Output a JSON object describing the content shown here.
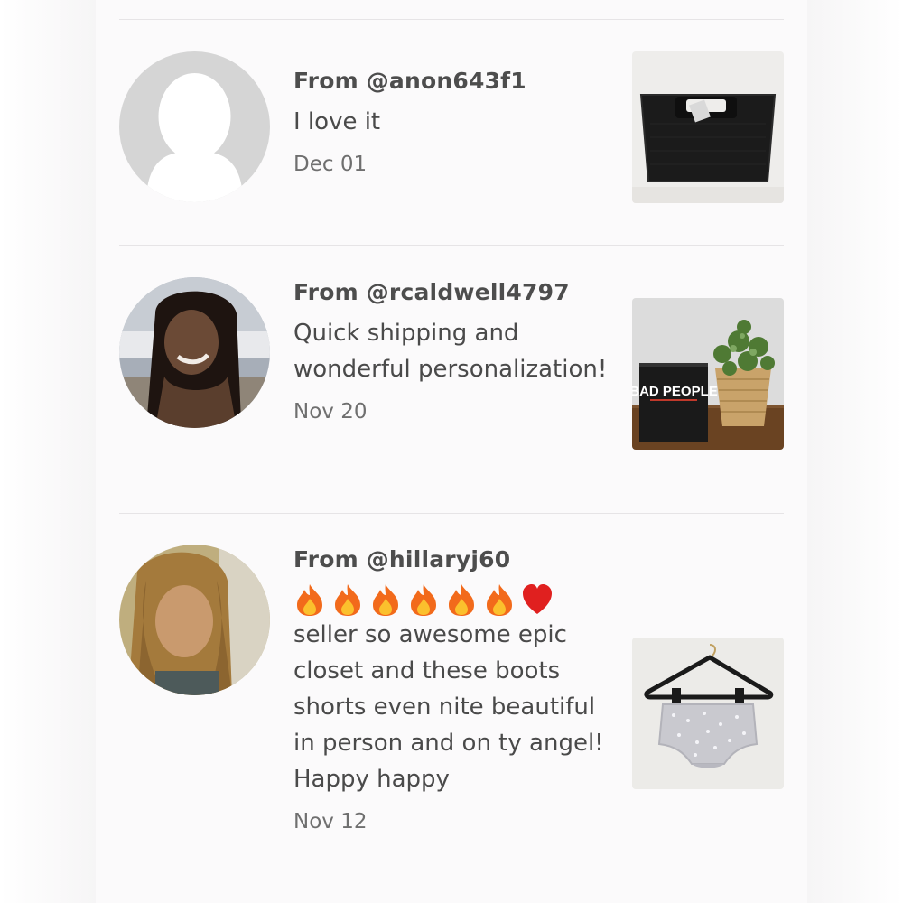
{
  "reviews": [
    {
      "from": "From @anon643f1",
      "comment": "I love it",
      "date": "Dec 01",
      "avatar_icon": "default-user-avatar",
      "product_thumb": "black-tote-bag"
    },
    {
      "from": "From @rcaldwell4797",
      "comment": "Quick shipping and wonderful personalization!",
      "date": "Nov 20",
      "avatar_icon": "user-photo",
      "product_thumb": "bad-people-game-and-plant",
      "product_box_text": "BAD PEOPLE"
    },
    {
      "from": "From @hillaryj60",
      "emojis": [
        "fire",
        "fire",
        "fire",
        "fire",
        "fire",
        "fire",
        "red-heart"
      ],
      "comment": "seller so awesome epic closet and these boots shorts even nite beautiful in person and on ty angel! Happy happy",
      "date": "Nov 12",
      "avatar_icon": "user-photo",
      "product_thumb": "sequin-shorts-on-hanger"
    }
  ],
  "colors": {
    "panel_bg": "#fbfafb",
    "divider": "#e6e4e6",
    "text": "#4a4a4a",
    "date": "#6f6f6f"
  }
}
